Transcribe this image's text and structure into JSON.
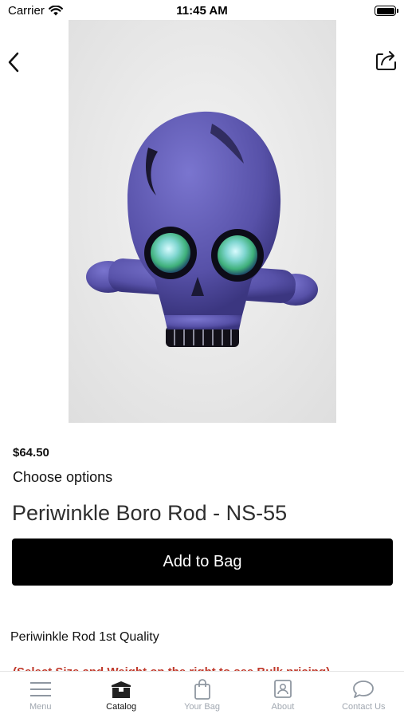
{
  "status_bar": {
    "carrier": "Carrier",
    "time": "11:45 AM"
  },
  "product": {
    "price": "$64.50",
    "options_label": "Choose options",
    "title": "Periwinkle Boro Rod - NS-55",
    "add_to_bag_label": "Add to Bag",
    "description": "Periwinkle Rod 1st Quality",
    "description_note": "(Select Size and Weight on the right to see Bulk pricing)"
  },
  "tab_bar": {
    "tabs": [
      {
        "label": "Menu",
        "icon": "menu-icon",
        "active": false
      },
      {
        "label": "Catalog",
        "icon": "catalog-icon",
        "active": true
      },
      {
        "label": "Your Bag",
        "icon": "bag-icon",
        "active": false
      },
      {
        "label": "About",
        "icon": "about-icon",
        "active": false
      },
      {
        "label": "Contact Us",
        "icon": "chat-icon",
        "active": false
      }
    ]
  },
  "colors": {
    "accent": "#000000",
    "inactive_tab": "#a0a7b0",
    "note": "#c0392b",
    "glass": "#5a55a8"
  }
}
